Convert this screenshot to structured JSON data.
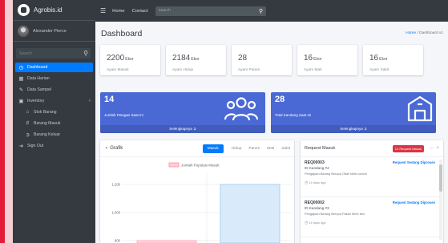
{
  "colors": {
    "accent": "#007bff",
    "banner": "#4a69d4",
    "sidebar": "#343a40",
    "badge": "#dc3545",
    "brand_red": "#e51b36"
  },
  "sidebar": {
    "brand": "Agrobis.id",
    "user": "Alexander Pierce",
    "search_placeholder": "Search",
    "items": [
      {
        "label": "Dashboard",
        "icon": "tachometer-icon"
      },
      {
        "label": "Data Harian",
        "icon": "calendar-icon"
      },
      {
        "label": "Data Sampel",
        "icon": "pencil-icon"
      },
      {
        "label": "Inventory",
        "icon": "box-icon"
      },
      {
        "label": "Stok Barang",
        "icon": "warehouse-icon"
      },
      {
        "label": "Barang Masuk",
        "icon": "dolly-icon"
      },
      {
        "label": "Barang Keluar",
        "icon": "export-icon"
      },
      {
        "label": "Sign Out",
        "icon": "signout-icon"
      }
    ]
  },
  "topbar": {
    "links": [
      "Home",
      "Contact"
    ],
    "search_placeholder": "Search"
  },
  "page": {
    "title": "Dashboard",
    "breadcrumb_home": "Home",
    "breadcrumb_sep": "/",
    "breadcrumb_current": "Dashboard v1"
  },
  "stats": [
    {
      "value": "2200",
      "unit": "Ekor",
      "label": "Ayam Masuk"
    },
    {
      "value": "2184",
      "unit": "Ekor",
      "label": "Ayam Hidup"
    },
    {
      "value": "28",
      "unit": "",
      "label": "Ayam Panen"
    },
    {
      "value": "16",
      "unit": "Ekor",
      "label": "Ayam Mati"
    },
    {
      "value": "16",
      "unit": "Ekor",
      "label": "Ayam Sakit"
    }
  ],
  "banners": [
    {
      "value": "14",
      "label": "Jumlah Petugas Saat Ini",
      "footer": "Selengkapnya",
      "icon": "users-icon"
    },
    {
      "value": "28",
      "label": "Total Kandang Saat Ini",
      "footer": "Selengkapnya",
      "icon": "barn-icon"
    }
  ],
  "chart_panel": {
    "title": "Grafik",
    "tabs": [
      "Masuk",
      "Hidup",
      "Panen",
      "Mati",
      "Sakit"
    ],
    "active_tab": "Masuk"
  },
  "chart_data": {
    "type": "bar",
    "legend": "Jumlah Populasi Masuk",
    "yticks": [
      1200,
      1000,
      800
    ],
    "series": [
      {
        "name": "Jumlah Populasi Masuk",
        "values": [
          800,
          1200
        ]
      }
    ],
    "ylim": [
      800,
      1200
    ]
  },
  "requests": {
    "title": "Request Masuk",
    "badge": "12 Request Masuk",
    "items": [
      {
        "code": "REQ00003",
        "status": "Request Sedang Diproses",
        "kandang": "ID Kandang #4",
        "desc": "Pengajuan Barang Berupa Obat Merk contoh",
        "time": "14 days ago"
      },
      {
        "code": "REQ00002",
        "status": "Request Sedang Diproses",
        "kandang": "ID Kandang #3",
        "desc": "Pengajuan Barang Berupa Pakan Merk bes",
        "time": "14 days ago"
      }
    ]
  }
}
